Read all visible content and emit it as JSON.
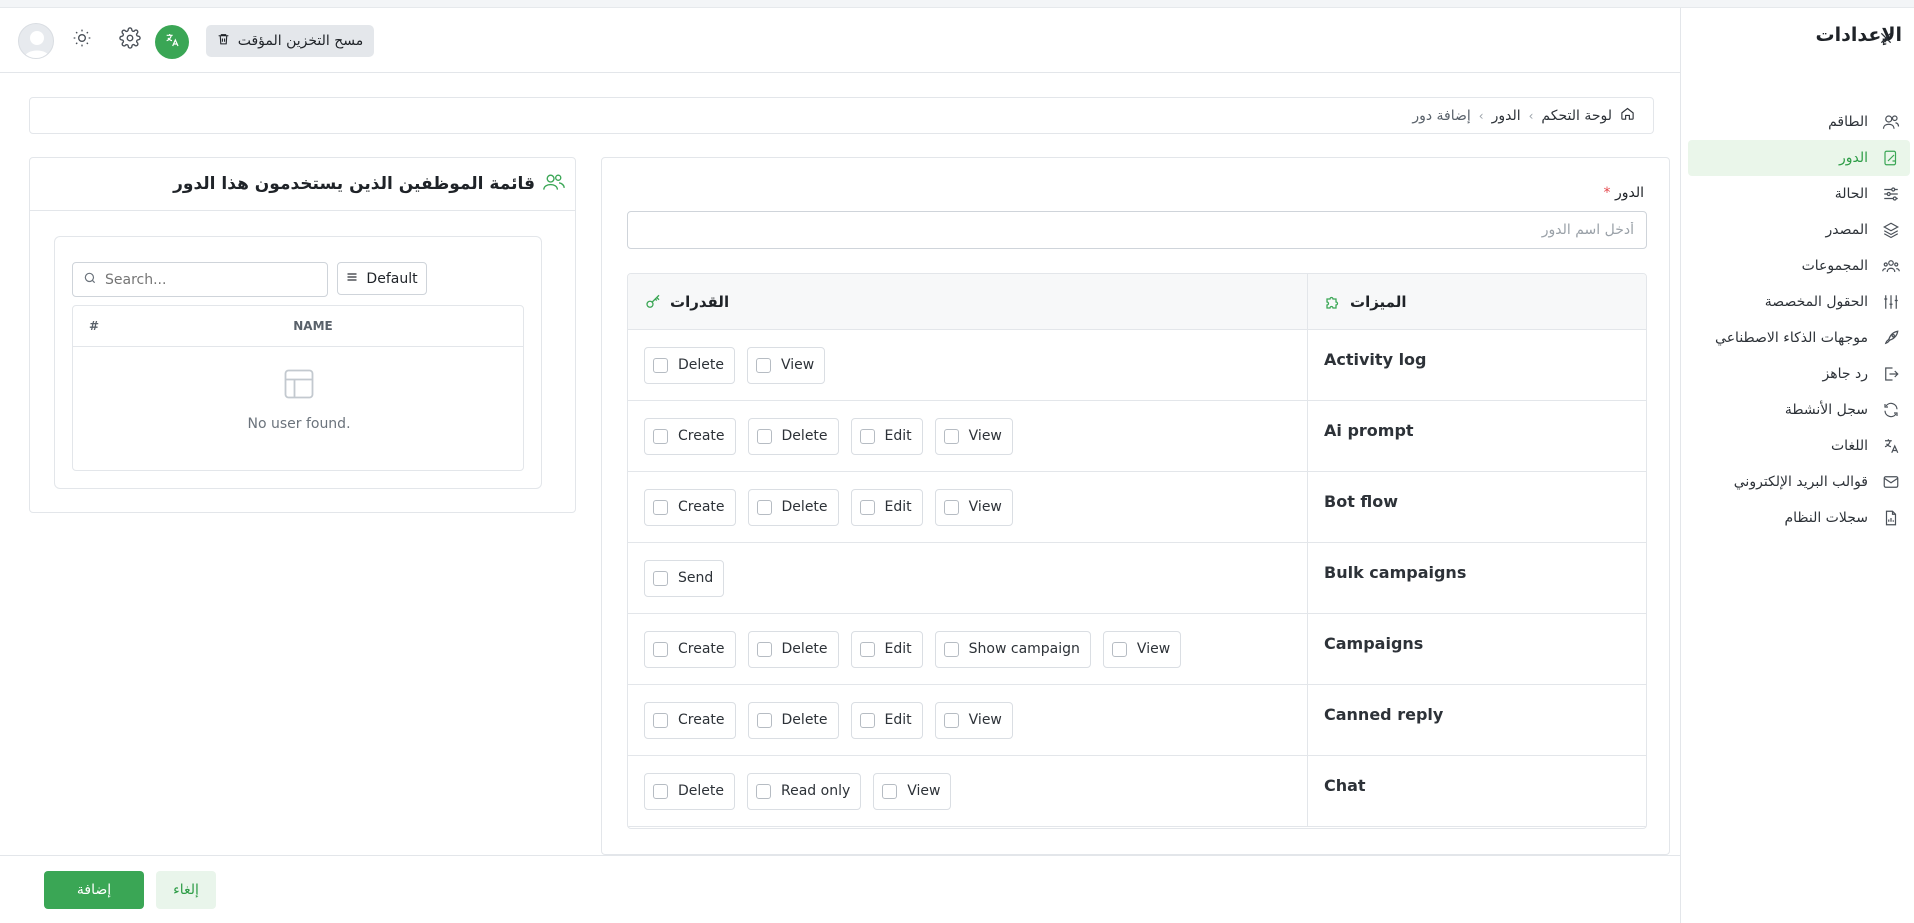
{
  "sidebar": {
    "title": "الإعدادات",
    "items": [
      {
        "label": "الطاقم",
        "icon": "users-icon",
        "active": false
      },
      {
        "label": "الدور",
        "icon": "role-badge-icon",
        "active": true
      },
      {
        "label": "الحالة",
        "icon": "sliders-icon",
        "active": false
      },
      {
        "label": "المصدر",
        "icon": "layers-icon",
        "active": false
      },
      {
        "label": "المجموعات",
        "icon": "group-icon",
        "active": false
      },
      {
        "label": "الحقول المخصصة",
        "icon": "custom-fields-icon",
        "active": false
      },
      {
        "label": "موجهات الذكاء الاصطناعي",
        "icon": "rocket-icon",
        "active": false
      },
      {
        "label": "رد جاهز",
        "icon": "reply-icon",
        "active": false
      },
      {
        "label": "سجل الأنشطة",
        "icon": "refresh-icon",
        "active": false
      },
      {
        "label": "اللغات",
        "icon": "translate-icon",
        "active": false
      },
      {
        "label": "قوالب البريد الإلكتروني",
        "icon": "mail-icon",
        "active": false
      },
      {
        "label": "سجلات النظام",
        "icon": "file-chart-icon",
        "active": false
      }
    ]
  },
  "header": {
    "clear_cache_label": "مسح التخزين المؤقت"
  },
  "breadcrumb": {
    "home": "لوحة التحكم",
    "section": "الدور",
    "current": "إضافة دور"
  },
  "users_card": {
    "title": "قائمة الموظفين الذين يستخدمون هذا الدور",
    "search_placeholder": "Search...",
    "default_label": "Default",
    "col_hash": "#",
    "col_name": "NAME",
    "empty_text": "No user found."
  },
  "role_form": {
    "label": "الدور",
    "required_mark": "*",
    "placeholder": "أدخل اسم الدور",
    "capabilities_header": "القدرات",
    "features_header": "الميزات",
    "rows": [
      {
        "feature": "Activity log",
        "caps": [
          "Delete",
          "View"
        ]
      },
      {
        "feature": "Ai prompt",
        "caps": [
          "Create",
          "Delete",
          "Edit",
          "View"
        ]
      },
      {
        "feature": "Bot flow",
        "caps": [
          "Create",
          "Delete",
          "Edit",
          "View"
        ]
      },
      {
        "feature": "Bulk campaigns",
        "caps": [
          "Send"
        ]
      },
      {
        "feature": "Campaigns",
        "caps": [
          "Create",
          "Delete",
          "Edit",
          "Show campaign",
          "View"
        ]
      },
      {
        "feature": "Canned reply",
        "caps": [
          "Create",
          "Delete",
          "Edit",
          "View"
        ]
      },
      {
        "feature": "Chat",
        "caps": [
          "Delete",
          "Read only",
          "View"
        ]
      }
    ]
  },
  "footer": {
    "add_label": "إضافة",
    "cancel_label": "إلغاء"
  },
  "colors": {
    "accent": "#3aa655",
    "accent_light": "#eaf6ea",
    "border": "#e3e6ea"
  }
}
